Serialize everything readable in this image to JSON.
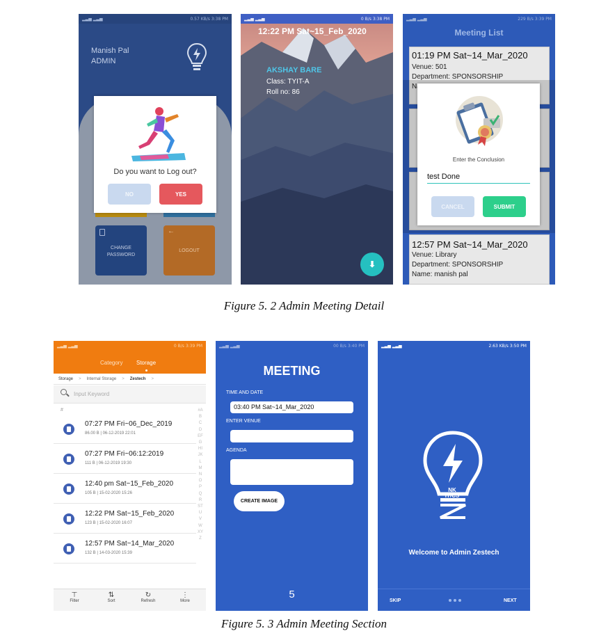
{
  "fig1": {
    "caption": "Figure 5. 2 Admin Meeting Detail",
    "logout_screen": {
      "status_right": "0.57 KB/s  3:38 PM",
      "user_name": "Manish Pal",
      "user_role": "ADMIN",
      "dialog_question": "Do you want to Log out?",
      "no_label": "NO",
      "yes_label": "YES",
      "change_password_label": "CHANGE PASSWORD",
      "logout_label": "LOGOUT"
    },
    "photo_screen": {
      "status_right": "0 B/s  3:38 PM",
      "timestamp": "12:22 PM Sat~15_Feb_2020",
      "student_name": "AKSHAY BARE",
      "class_line": "Class: TYIT-A",
      "roll_line": "Roll no: 86"
    },
    "meeting_list_screen": {
      "status_right": "229 B/s  3:39 PM",
      "title": "Meeting List",
      "first_meeting": {
        "time": "01:19 PM Sat~14_Mar_2020",
        "venue": "Venue: 501",
        "department": "Department: SPONSORSHIP",
        "name_partial": "Na"
      },
      "last_meeting": {
        "time": "12:57 PM Sat~14_Mar_2020",
        "venue": "Venue: Library",
        "department": "Department: SPONSORSHIP",
        "name": "Name: manish pal"
      },
      "dialog_prompt": "Enter the Conclusion",
      "conclusion_value": "test Done",
      "cancel_label": "CANCEL",
      "submit_label": "SUBMIT"
    }
  },
  "fig2": {
    "caption": "Figure 5. 3 Admin Meeting Section",
    "storage_screen": {
      "status_right": "0 B/s  3:39 PM",
      "tab_category": "Category",
      "tab_storage": "Storage",
      "breadcrumb": [
        "Storage",
        "Internal Storage",
        "Zestech"
      ],
      "search_placeholder": "Input Keyword",
      "hash_label": "#",
      "alphabet": "#ABCDEFGHIJKLMNOPQRSTUVWXYZ",
      "files": [
        {
          "name": "07:27 PM Fri~06_Dec_2019",
          "meta": "86.00 B | 06-12-2019 22:01"
        },
        {
          "name": "07:27 PM Fri~06:12:2019",
          "meta": "111 B | 06-12-2019 19:30"
        },
        {
          "name": "12:40 pm Sat~15_Feb_2020",
          "meta": "105 B | 15-02-2020 15:26"
        },
        {
          "name": "12:22 PM Sat~15_Feb_2020",
          "meta": "123 B | 15-02-2020 16:07"
        },
        {
          "name": "12:57 PM Sat~14_Mar_2020",
          "meta": "132 B | 14-03-2020 15:39"
        }
      ],
      "bottom_filter": "Filter",
      "bottom_sort": "Sort",
      "bottom_refresh": "Refresh",
      "bottom_more": "More"
    },
    "meeting_form_screen": {
      "status_right": "00 B/s  3:40 PM",
      "title": "MEETING",
      "time_label": "TIME AND DATE",
      "time_value": "03:40 PM Sat~14_Mar_2020",
      "venue_label": "ENTER VENUE",
      "agenda_label": "AGENDA",
      "create_image_label": "CREATE IMAGE",
      "page_number": "5"
    },
    "welcome_screen": {
      "status_right": "2.63 KB/s  3:50 PM",
      "logo_text": "NK IT/CS",
      "welcome_text": "Welcome to Admin Zestech",
      "skip_label": "SKIP",
      "next_label": "NEXT"
    }
  },
  "colors": {
    "blue": "#2f5fc4",
    "dark_blue": "#243e73",
    "orange": "#f07c10",
    "red": "#e5585d",
    "green": "#2dcf8b",
    "teal": "#25c0c0"
  }
}
